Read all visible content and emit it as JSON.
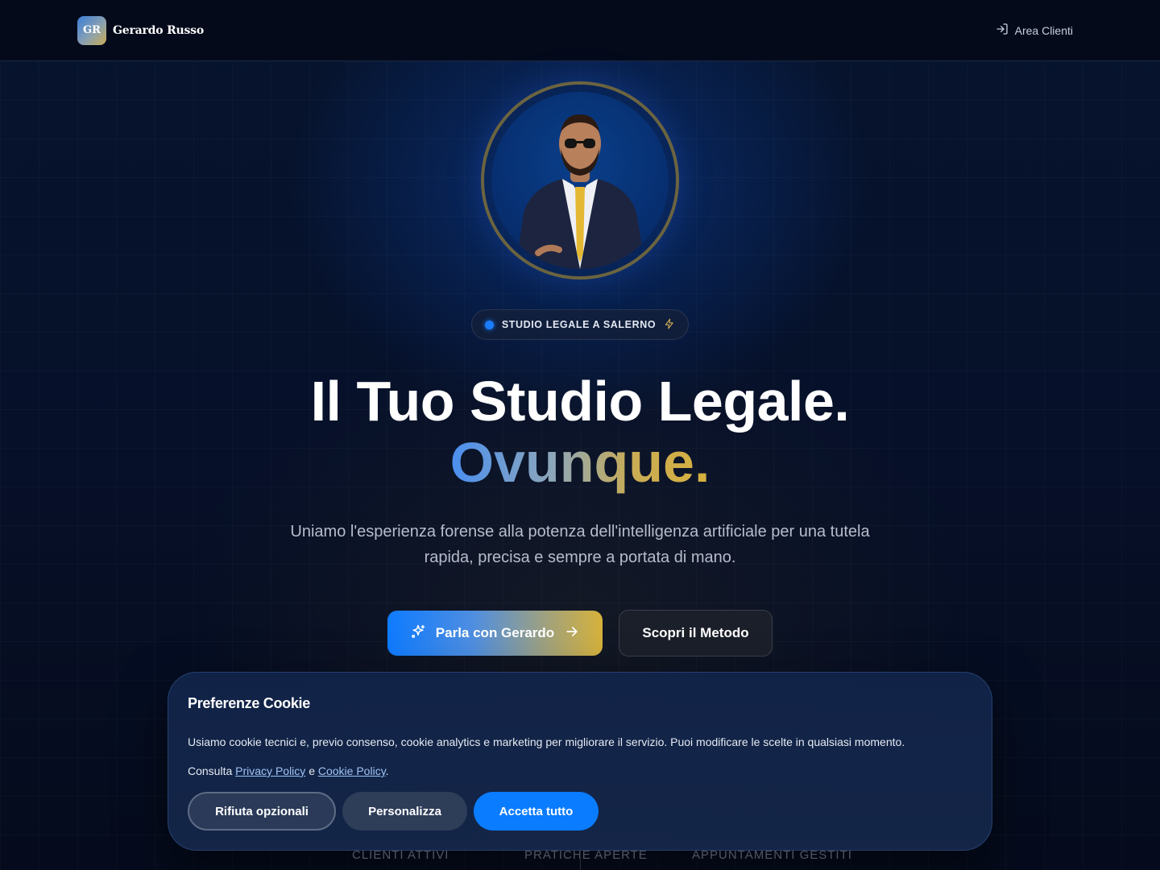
{
  "header": {
    "logo_initials": "GR",
    "brand_name": "Gerardo Russo",
    "area_clienti_label": "Area Clienti"
  },
  "hero": {
    "badge_text": "STUDIO LEGALE A SALERNO",
    "title_line1": "Il Tuo Studio Legale.",
    "title_line2": "Ovunque.",
    "subtitle": "Uniamo l'esperienza forense alla potenza dell'intelligenza artificiale per una tutela rapida, precisa e sempre a portata di mano.",
    "primary_button": "Parla con Gerardo",
    "secondary_button": "Scopri il Metodo"
  },
  "stats": {
    "items": [
      "CLIENTI ATTIVI",
      "PRATICHE APERTE",
      "APPUNTAMENTI GESTITI"
    ]
  },
  "cookie_banner": {
    "title": "Preferenze Cookie",
    "text": "Usiamo cookie tecnici e, previo consenso, cookie analytics e marketing per migliorare il servizio. Puoi modificare le scelte in qualsiasi momento.",
    "consult_prefix": "Consulta",
    "privacy_link": "Privacy Policy",
    "conjunction": "e",
    "cookie_link": "Cookie Policy",
    "suffix": ".",
    "reject_label": "Rifiuta opzionali",
    "customize_label": "Personalizza",
    "accept_label": "Accetta tutto"
  },
  "colors": {
    "accent_blue": "#0a7cff",
    "accent_gold": "#d6b23b",
    "background": "#050b1c"
  }
}
